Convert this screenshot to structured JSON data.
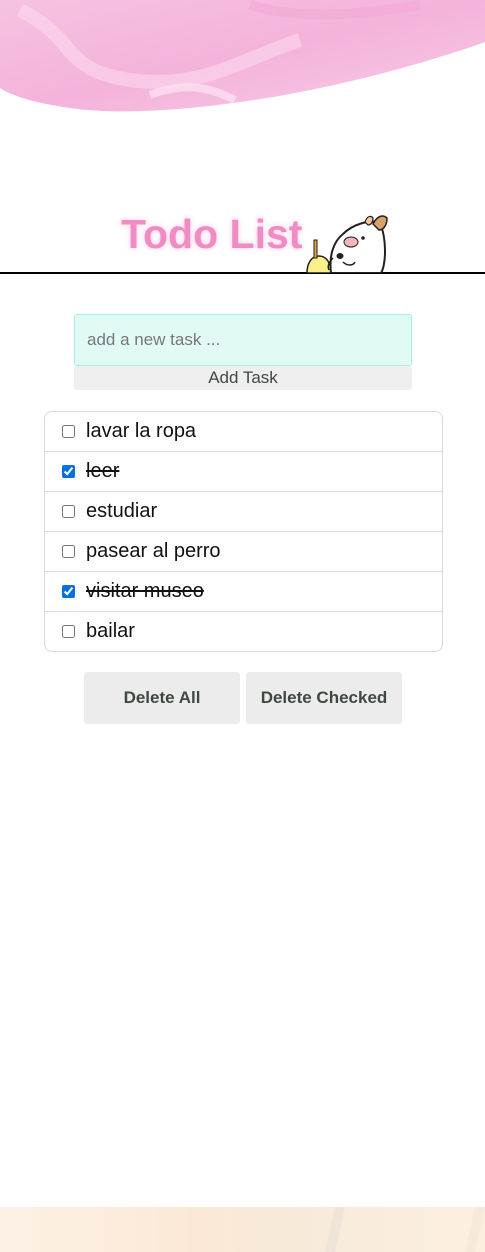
{
  "header": {
    "title": "Todo List"
  },
  "form": {
    "placeholder": "add a new task ...",
    "value": "",
    "add_label": "Add Task"
  },
  "tasks": [
    {
      "text": "lavar la ropa",
      "checked": false
    },
    {
      "text": "leer",
      "checked": true
    },
    {
      "text": "estudiar",
      "checked": false
    },
    {
      "text": "pasear al perro",
      "checked": false
    },
    {
      "text": "visitar museo",
      "checked": true
    },
    {
      "text": "bailar",
      "checked": false
    }
  ],
  "actions": {
    "delete_all_label": "Delete All",
    "delete_checked_label": "Delete Checked"
  },
  "theme": {
    "title_color": "#f08cc3",
    "input_bg": "#e2faf6",
    "checkbox_accent": "#0b6fe0",
    "button_text": "#3d4a42"
  },
  "icons": {
    "mascot": "cartoon-dog-mascot-icon",
    "top_decoration": "pink-watercolor-wave",
    "bottom_decoration": "peach-watercolor-band"
  }
}
